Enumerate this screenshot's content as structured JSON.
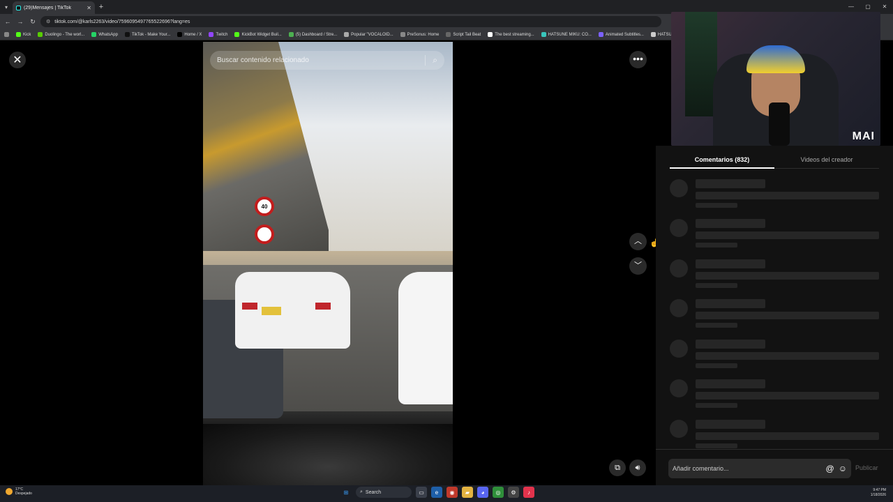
{
  "browser": {
    "tab_title": "(29)Mensajes | TikTok",
    "url": "tiktok.com/@karls2263/video/7596095497765522696?lang=es",
    "bookmarks": [
      {
        "label": "Kick",
        "color": "#53fc18"
      },
      {
        "label": "Duolingo - The worl...",
        "color": "#58cc02"
      },
      {
        "label": "WhatsApp",
        "color": "#25d366"
      },
      {
        "label": "TikTok - Make Your...",
        "color": "#111111"
      },
      {
        "label": "Home / X",
        "color": "#000000"
      },
      {
        "label": "Twitch",
        "color": "#9146ff"
      },
      {
        "label": "KickBot Widget Buil...",
        "color": "#53fc18"
      },
      {
        "label": "(5) Dashboard / Stre...",
        "color": "#4caf50"
      },
      {
        "label": "Popular \"VOCALOID...",
        "color": "#aaaaaa"
      },
      {
        "label": "PreSonus: Home",
        "color": "#888888"
      },
      {
        "label": "Script Tail Beat",
        "color": "#666666"
      },
      {
        "label": "The best streaming...",
        "color": "#ffffff"
      },
      {
        "label": "HATSUNE MIKU: CO...",
        "color": "#39c5bb"
      },
      {
        "label": "Animated Subtitles...",
        "color": "#7b61ff"
      },
      {
        "label": "HATSUNE",
        "color": "#cccccc"
      }
    ]
  },
  "video": {
    "search_placeholder": "Buscar contenido relacionado",
    "sign_text": "40"
  },
  "webcam": {
    "brand": "MAI"
  },
  "panel": {
    "tabs": [
      {
        "label": "Comentarios (832)",
        "active": true
      },
      {
        "label": "Videos del creador",
        "active": false
      }
    ],
    "comment_placeholder": "Añadir comentario...",
    "publish_label": "Publicar"
  },
  "taskbar": {
    "temp": "17°C",
    "condition": "Despejado",
    "search_label": "Search",
    "time": "9:47 PM",
    "date": "1/18/2026"
  },
  "icons": {
    "close": "close-icon",
    "more": "more-icon",
    "up": "chevron-up-icon",
    "down": "chevron-down-icon",
    "volume": "volume-icon",
    "float": "floating-player-icon",
    "mention": "at-icon",
    "emoji": "emoji-icon",
    "search": "search-icon"
  }
}
